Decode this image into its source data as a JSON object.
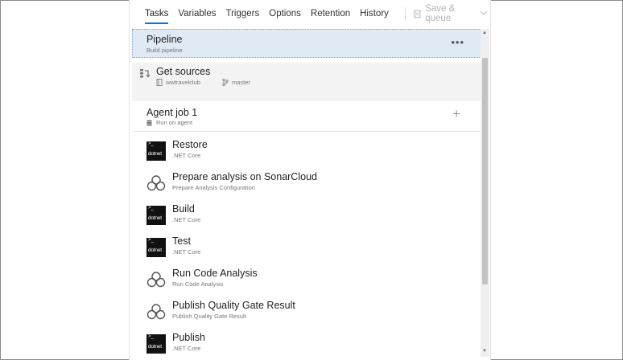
{
  "tabs": [
    {
      "label": "Tasks",
      "active": true
    },
    {
      "label": "Variables",
      "active": false
    },
    {
      "label": "Triggers",
      "active": false
    },
    {
      "label": "Options",
      "active": false
    },
    {
      "label": "Retention",
      "active": false
    },
    {
      "label": "History",
      "active": false
    }
  ],
  "toolbar": {
    "save_label": "Save & queue",
    "save_icon": "save-icon",
    "dropdown_icon": "chevron-down-icon"
  },
  "pipeline": {
    "title": "Pipeline",
    "subtitle": "Build pipeline",
    "more_label": "•••"
  },
  "get_sources": {
    "title": "Get sources",
    "repo": "wwtravelclub",
    "branch": "master"
  },
  "agent_job": {
    "title": "Agent job 1",
    "subtitle": "Run on agent",
    "add_label": "+"
  },
  "tasks": [
    {
      "title": "Restore",
      "subtitle": ".NET Core",
      "icon": "dotnet-icon"
    },
    {
      "title": "Prepare analysis on SonarCloud",
      "subtitle": "Prepare Analysis Configuration",
      "icon": "sonarcloud-icon"
    },
    {
      "title": "Build",
      "subtitle": ".NET Core",
      "icon": "dotnet-icon"
    },
    {
      "title": "Test",
      "subtitle": ".NET Core",
      "icon": "dotnet-icon"
    },
    {
      "title": "Run Code Analysis",
      "subtitle": "Run Code Analysis",
      "icon": "sonarcloud-icon"
    },
    {
      "title": "Publish Quality Gate Result",
      "subtitle": "Publish Quality Gate Result",
      "icon": "sonarcloud-icon"
    },
    {
      "title": "Publish",
      "subtitle": ".NET Core",
      "icon": "dotnet-icon"
    }
  ],
  "dotnet_icon_text": "dotnet",
  "dotnet_icon_prompt": ">_",
  "colors": {
    "accent": "#0078d4",
    "selected_bg": "#dfeaf5",
    "section_bg": "#f3f3f3"
  }
}
